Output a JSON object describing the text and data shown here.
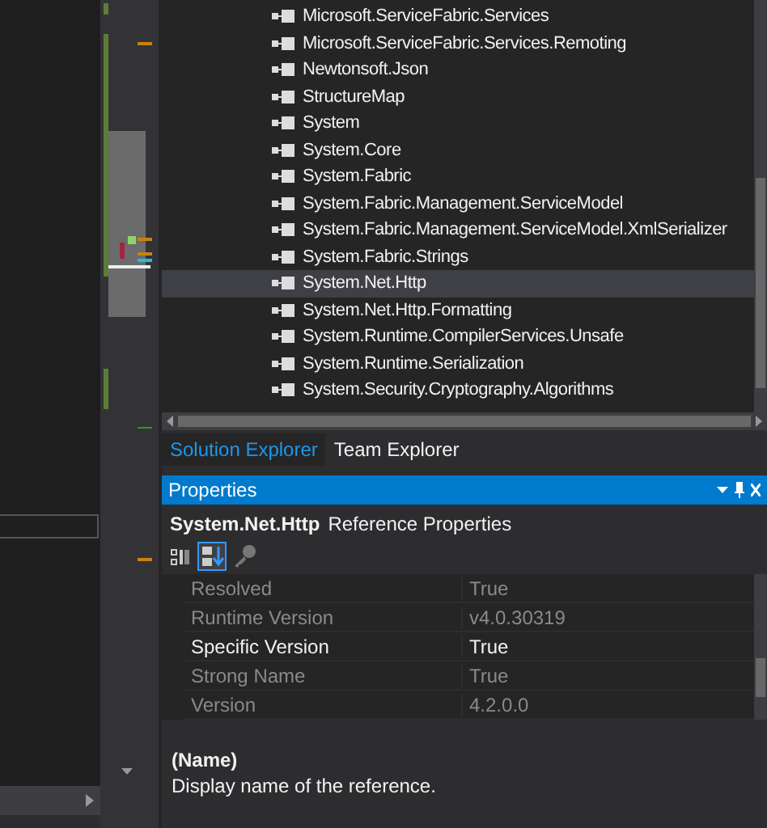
{
  "solution_tree": {
    "items": [
      {
        "label": "Microsoft.ServiceFabric.Services",
        "selected": false
      },
      {
        "label": "Microsoft.ServiceFabric.Services.Remoting",
        "selected": false
      },
      {
        "label": "Newtonsoft.Json",
        "selected": false
      },
      {
        "label": "StructureMap",
        "selected": false
      },
      {
        "label": "System",
        "selected": false
      },
      {
        "label": "System.Core",
        "selected": false
      },
      {
        "label": "System.Fabric",
        "selected": false
      },
      {
        "label": "System.Fabric.Management.ServiceModel",
        "selected": false
      },
      {
        "label": "System.Fabric.Management.ServiceModel.XmlSerializer",
        "selected": false
      },
      {
        "label": "System.Fabric.Strings",
        "selected": false
      },
      {
        "label": "System.Net.Http",
        "selected": true
      },
      {
        "label": "System.Net.Http.Formatting",
        "selected": false
      },
      {
        "label": "System.Runtime.CompilerServices.Unsafe",
        "selected": false
      },
      {
        "label": "System.Runtime.Serialization",
        "selected": false
      },
      {
        "label": "System.Security.Cryptography.Algorithms",
        "selected": false
      }
    ]
  },
  "tabs": [
    {
      "label": "Solution Explorer",
      "selected": true
    },
    {
      "label": "Team Explorer",
      "selected": false
    }
  ],
  "properties": {
    "title": "Properties",
    "object_name": "System.Net.Http",
    "object_type": "Reference Properties",
    "rows": [
      {
        "name": "Resolved",
        "value": "True",
        "disabled": true
      },
      {
        "name": "Runtime Version",
        "value": "v4.0.30319",
        "disabled": true
      },
      {
        "name": "Specific Version",
        "value": "True",
        "disabled": false
      },
      {
        "name": "Strong Name",
        "value": "True",
        "disabled": true
      },
      {
        "name": "Version",
        "value": "4.2.0.0",
        "disabled": true
      }
    ],
    "description_title": "(Name)",
    "description": "Display name of the reference."
  }
}
